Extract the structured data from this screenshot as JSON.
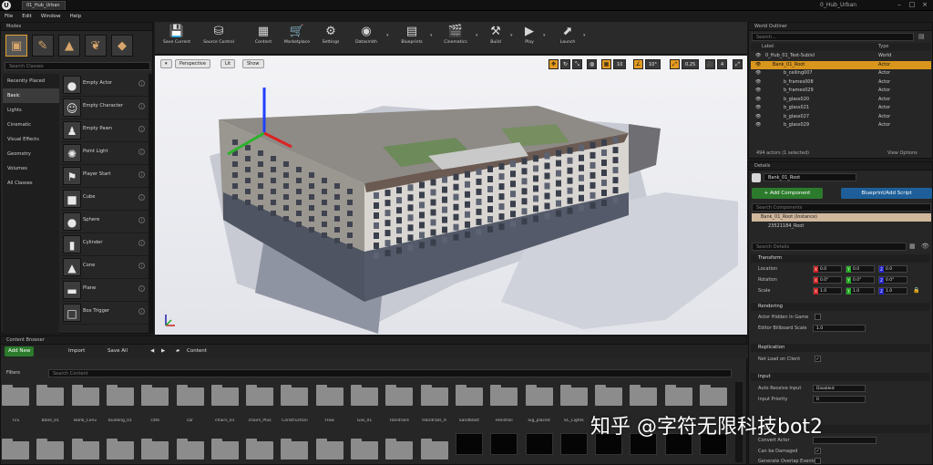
{
  "window": {
    "tab": "01_Hub_Urban",
    "title": "0_Hub_Urban",
    "logo": "U"
  },
  "menu": [
    "File",
    "Edit",
    "Window",
    "Help"
  ],
  "modes": {
    "title": "Modes",
    "search_placeholder": "Search Classes",
    "categories": [
      "Recently Placed",
      "Basic",
      "Lights",
      "Cinematic",
      "Visual Effects",
      "Geometry",
      "Volumes",
      "All Classes"
    ],
    "selected_category": "Basic",
    "items": [
      "Empty Actor",
      "Empty Character",
      "Empty Pawn",
      "Point Light",
      "Player Start",
      "Cube",
      "Sphere",
      "Cylinder",
      "Cone",
      "Plane",
      "Box Trigger"
    ]
  },
  "toolbar": {
    "buttons": [
      "Save Current",
      "Source Control",
      "Content",
      "Marketplace",
      "Settings",
      "Datasmith",
      "Blueprints",
      "Cinematics",
      "Build",
      "Play",
      "Launch"
    ]
  },
  "viewport": {
    "perspective": "Perspective",
    "lit": "Lit",
    "show": "Show",
    "snap_grid": "10",
    "snap_rot": "10°",
    "scale_val": "0.25",
    "cam_speed": "4"
  },
  "outliner": {
    "title": "World Outliner",
    "search_placeholder": "Search...",
    "col_label": "Label",
    "col_type": "Type",
    "rows": [
      {
        "label": "0_Hub_01_Test-Sublvl",
        "type": "World"
      },
      {
        "label": "Bank_01_Root",
        "type": "Actor",
        "sel": true
      },
      {
        "label": "b_ceiling007",
        "type": "Actor"
      },
      {
        "label": "b_frames008",
        "type": "Actor"
      },
      {
        "label": "b_frames029",
        "type": "Actor"
      },
      {
        "label": "b_glass020",
        "type": "Actor"
      },
      {
        "label": "b_glass021",
        "type": "Actor"
      },
      {
        "label": "b_glass027",
        "type": "Actor"
      },
      {
        "label": "b_glass029",
        "type": "Actor"
      }
    ],
    "footer": "494 actors (1 selected)",
    "view_options": "View Options"
  },
  "details": {
    "title": "Details",
    "name": "Bank_01_Root",
    "add_component": "+ Add Component",
    "blueprint": "Blueprint/Add Script",
    "search_comp": "Search Components",
    "root_instance": "Bank_01_Root (Instance)",
    "child": "23521184_Root",
    "search_details": "Search Details",
    "transform": "Transform",
    "location": "Location",
    "rotation": "Rotation",
    "scale": "Scale",
    "loc": [
      "0.0",
      "0.0",
      "0.0"
    ],
    "rot": [
      "0.0°",
      "0.0°",
      "0.0°"
    ],
    "scl": [
      "1.0",
      "1.0",
      "1.0"
    ],
    "rendering": "Rendering",
    "actor_hidden": "Actor Hidden In Game",
    "billboard": "Editor Billboard Scale",
    "billboard_val": "1.0",
    "replication": "Replication",
    "net_load": "Net Load on Client",
    "input": "Input",
    "auto_input": "Auto Receive Input",
    "auto_input_val": "Disabled",
    "input_priority": "Input Priority",
    "input_priority_val": "0",
    "actor": "Actor",
    "convert": "Convert Actor",
    "can_damaged": "Can be Damaged",
    "gen_overlap": "Generate Overlap Events"
  },
  "content_browser": {
    "title": "Content Browser",
    "add_new": "Add New",
    "import": "Import",
    "save_all": "Save All",
    "path": "Content",
    "filters": "Filters",
    "search_placeholder": "Search Content",
    "folders": [
      "TLS",
      "Bank_01",
      "Bank_Conv",
      "building_01",
      "cafe",
      "car",
      "chairs_01",
      "chairs_Plus",
      "Construction",
      "Flow",
      "Gas_01",
      "Handrails",
      "Handrails_A",
      "Sandblast",
      "Handrail",
      "Sig_placed",
      "SC_Lights"
    ]
  },
  "watermark": "知乎 @字符无限科技bot2"
}
